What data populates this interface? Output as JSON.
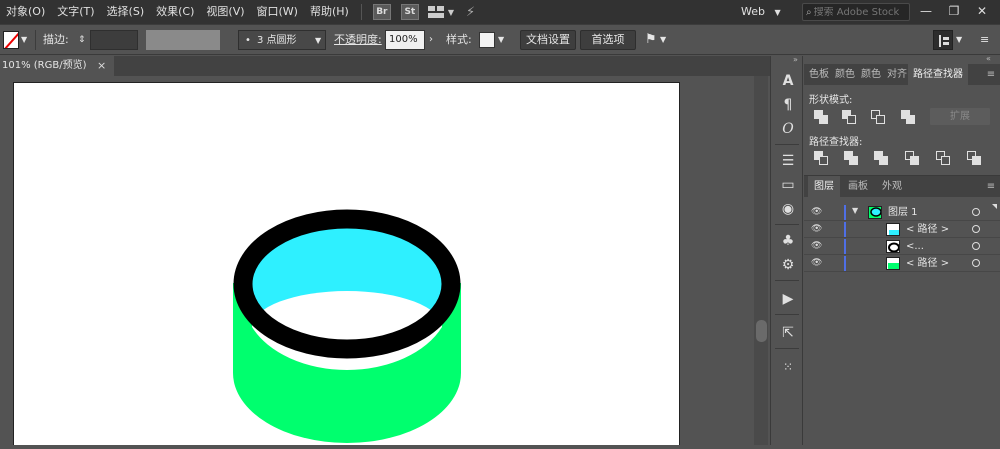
{
  "menubar": {
    "items": [
      "对象(O)",
      "文字(T)",
      "选择(S)",
      "效果(C)",
      "视图(V)",
      "窗口(W)",
      "帮助(H)"
    ],
    "bridge_label": "Br",
    "stock_label": "St",
    "workspace": "Web",
    "search_placeholder": "搜索 Adobe Stock",
    "minimize": "—",
    "restore": "❐",
    "close": "✕"
  },
  "controlbar": {
    "stroke_label": "描边:",
    "brush_value": "3 点圆形",
    "opacity_label": "不透明度:",
    "opacity_value": "100%",
    "style_label": "样式:",
    "doc_setup_label": "文档设置",
    "preferences_label": "首选项"
  },
  "document_tab": {
    "title": "101% (RGB/预览)",
    "close": "×"
  },
  "pathfinder_panel": {
    "tabs": [
      "色板",
      "颜色",
      "颜色",
      "对齐",
      "路径查找器"
    ],
    "shape_modes_label": "形状模式:",
    "pathfinders_label": "路径查找器:",
    "expand_label": "扩展"
  },
  "layers_panel": {
    "tabs": [
      "图层",
      "画板",
      "外观"
    ],
    "layers": [
      {
        "name": "图层 1"
      },
      {
        "name": "< 路径 >"
      },
      {
        "name": "<..."
      },
      {
        "name": "< 路径 >"
      }
    ]
  },
  "colors": {
    "cylinder_body": "#00ff6e",
    "cylinder_top": "#2ef0ff",
    "ring": "#000000",
    "layer_color_bar": "#4f6fe6"
  }
}
